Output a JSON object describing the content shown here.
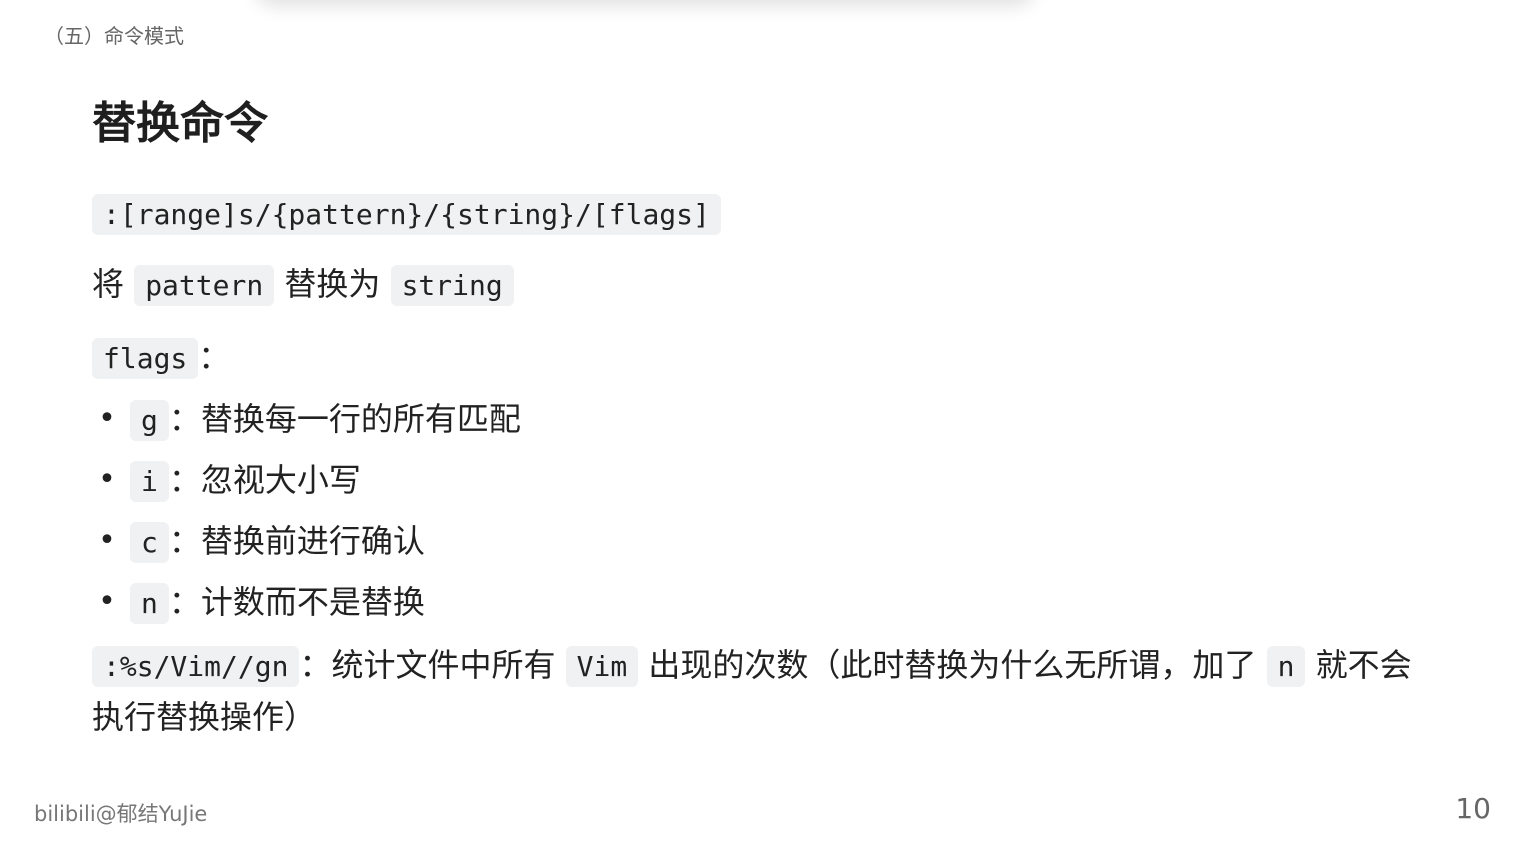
{
  "header": {
    "section_label": "（五）命令模式"
  },
  "title": "替换命令",
  "syntax": ":[range]s/{pattern}/{string}/[flags]",
  "replace_line": {
    "prefix": "将",
    "pattern_code": "pattern",
    "middle": "替换为",
    "string_code": "string"
  },
  "flags_line": {
    "code": "flags",
    "suffix": "："
  },
  "flags": [
    {
      "code": "g",
      "sep": "：",
      "desc": "替换每一行的所有匹配"
    },
    {
      "code": "i",
      "sep": "：",
      "desc": "忽视大小写"
    },
    {
      "code": "c",
      "sep": "：",
      "desc": "替换前进行确认"
    },
    {
      "code": "n",
      "sep": "：",
      "desc": "计数而不是替换"
    }
  ],
  "bullet_glyph": "•",
  "example": {
    "code": ":%s/Vim//gn",
    "text1": "：统计文件中所有",
    "vim_code": "Vim",
    "text2": "出现的次数（此时替换为什么无所谓，加了",
    "n_code": "n",
    "text3": "就不会执行替换操作）"
  },
  "footer": {
    "credit": "bilibili@郁结YuJie",
    "page_number": "10"
  },
  "colors": {
    "code_background": "#f0f1f2",
    "text": "#222222",
    "muted": "#666666"
  }
}
